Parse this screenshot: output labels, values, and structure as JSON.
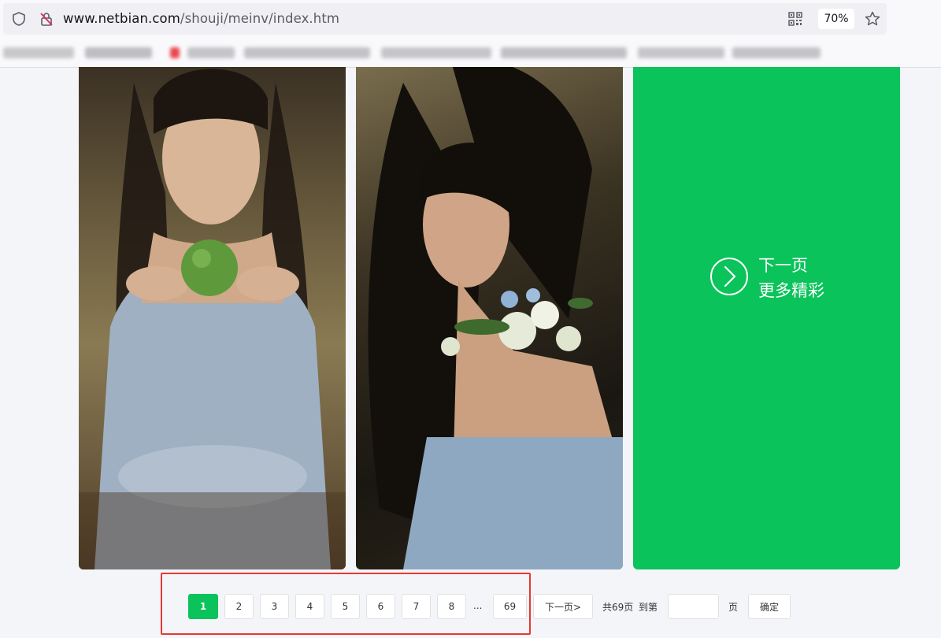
{
  "browser": {
    "url_host": "www.netbian.com",
    "url_path": "/shouji/meinv/index.htm",
    "zoom": "70%",
    "icons": [
      "shield-icon",
      "insecure-lock-icon",
      "qr-code-icon",
      "star-icon"
    ]
  },
  "gallery": {
    "next_card": {
      "line1": "下一页",
      "line2": "更多精彩",
      "color": "#0ac35a",
      "icon": "chevron-right-circle-icon"
    }
  },
  "pagination": {
    "pages": [
      "1",
      "2",
      "3",
      "4",
      "5",
      "6",
      "7",
      "8"
    ],
    "ellipsis": "...",
    "last_page": "69",
    "next_label": "下一页>",
    "total_label": "共69页",
    "goto_label": "到第",
    "page_suffix": "页",
    "confirm_label": "确定",
    "active_page": "1",
    "accent_color": "#0ac35a",
    "highlight_color": "#e53935"
  }
}
